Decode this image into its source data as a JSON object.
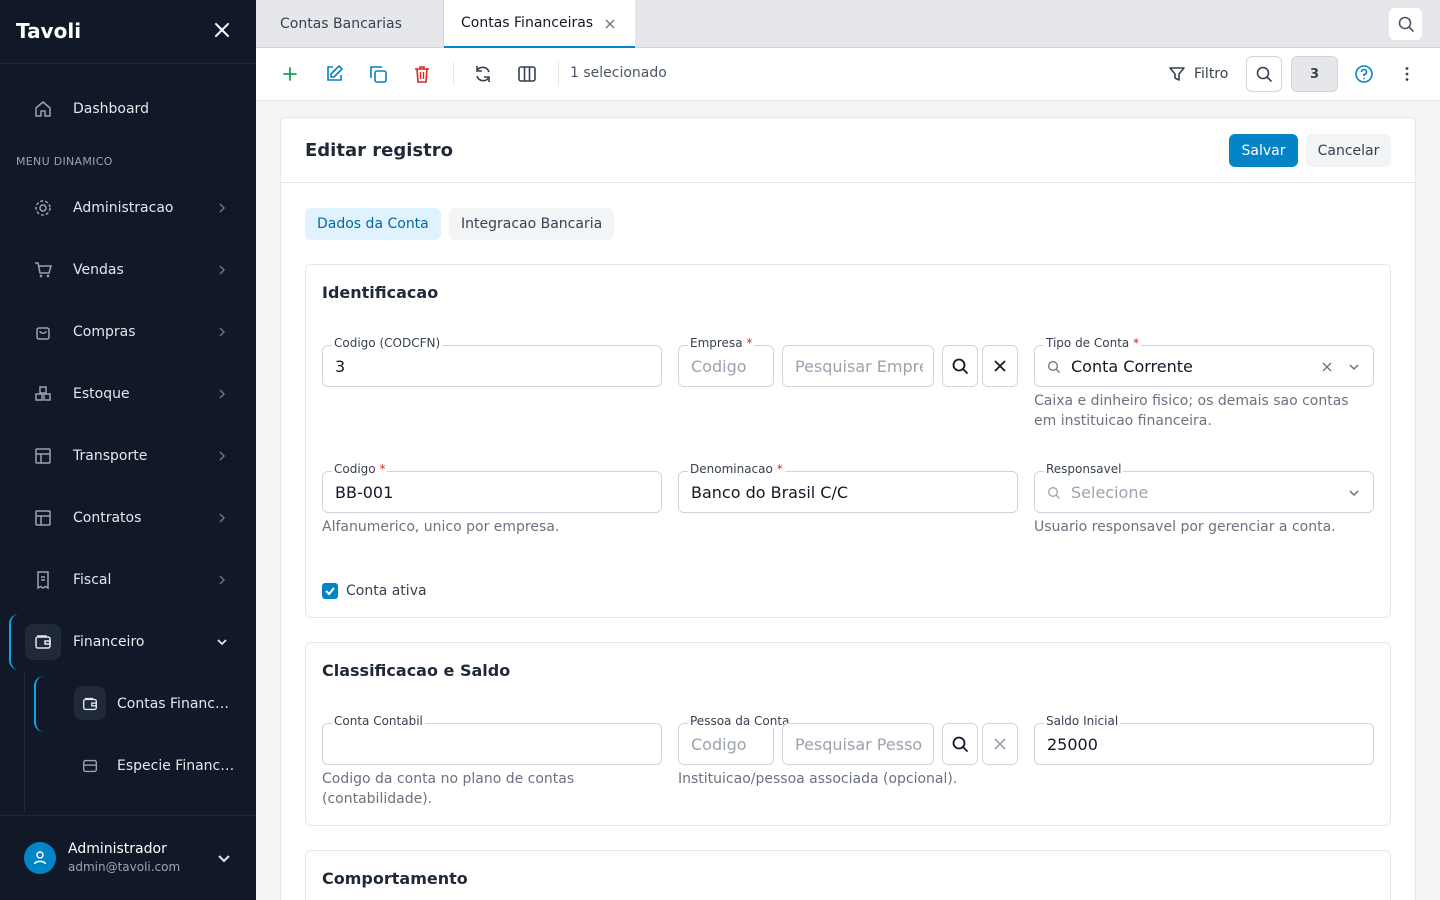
{
  "app": {
    "brand": "Tavoli"
  },
  "sidebar": {
    "section_label": "MENU DINAMICO",
    "items": [
      {
        "label": "Dashboard"
      },
      {
        "label": "Administracao"
      },
      {
        "label": "Vendas"
      },
      {
        "label": "Compras"
      },
      {
        "label": "Estoque"
      },
      {
        "label": "Transporte"
      },
      {
        "label": "Contratos"
      },
      {
        "label": "Fiscal"
      },
      {
        "label": "Financeiro"
      }
    ],
    "subitems": [
      {
        "label": "Contas Financeiras"
      },
      {
        "label": "Especie Financeira"
      }
    ],
    "user": {
      "name": "Administrador",
      "email": "admin@tavoli.com"
    }
  },
  "tabs": [
    {
      "label": "Contas Bancarias"
    },
    {
      "label": "Contas Financeiras"
    }
  ],
  "toolbar": {
    "selection_text": "1 selecionado",
    "filter_label": "Filtro",
    "count_badge": "3"
  },
  "form": {
    "title": "Editar registro",
    "save_label": "Salvar",
    "cancel_label": "Cancelar",
    "tabs": [
      {
        "label": "Dados da Conta"
      },
      {
        "label": "Integracao Bancaria"
      }
    ],
    "identificacao": {
      "title": "Identificacao",
      "codcfn": {
        "label": "Codigo (CODCFN)",
        "value": "3"
      },
      "empresa": {
        "label": "Empresa",
        "code_placeholder": "Codigo",
        "search_placeholder": "Pesquisar Empresa"
      },
      "tipo_conta": {
        "label": "Tipo de Conta",
        "value": "Conta Corrente",
        "hint": "Caixa e dinheiro fisico; os demais sao contas em instituicao financeira."
      },
      "codigo": {
        "label": "Codigo",
        "value": "BB-001",
        "hint": "Alfanumerico, unico por empresa."
      },
      "denominacao": {
        "label": "Denominacao",
        "value": "Banco do Brasil C/C"
      },
      "responsavel": {
        "label": "Responsavel",
        "placeholder": "Selecione",
        "hint": "Usuario responsavel por gerenciar a conta."
      },
      "ativa": {
        "label": "Conta ativa",
        "checked": true
      }
    },
    "classificacao": {
      "title": "Classificacao e Saldo",
      "conta_contabil": {
        "label": "Conta Contabil",
        "value": "",
        "hint": "Codigo da conta no plano de contas (contabilidade)."
      },
      "pessoa": {
        "label": "Pessoa da Conta",
        "code_placeholder": "Codigo",
        "search_placeholder": "Pesquisar Pessoa",
        "hint": "Instituicao/pessoa associada (opcional)."
      },
      "saldo_inicial": {
        "label": "Saldo Inicial",
        "value": "25000"
      }
    },
    "comportamento": {
      "title": "Comportamento"
    }
  },
  "colors": {
    "sidebar_bg": "#111827",
    "accent": "#0284c7",
    "danger": "#dc2626",
    "add": "#16a34a"
  }
}
